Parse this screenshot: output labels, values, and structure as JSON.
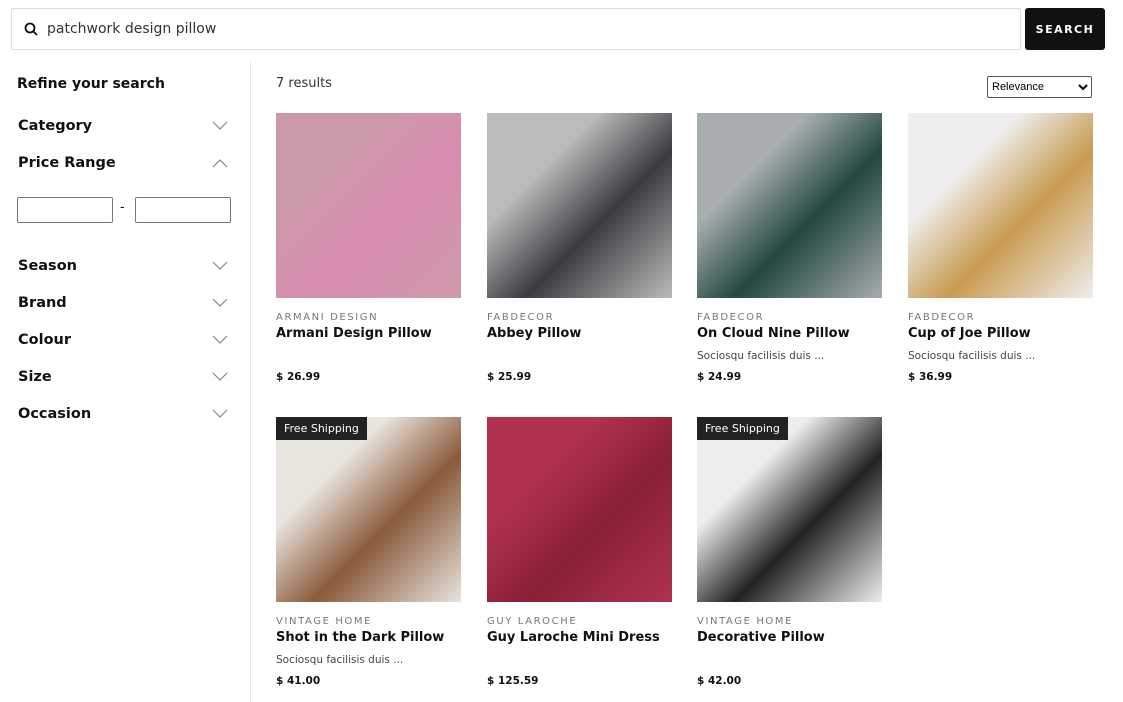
{
  "search": {
    "value": "patchwork design pillow",
    "button": "SEARCH",
    "icon": "search-icon"
  },
  "sidebar": {
    "title": "Refine your search",
    "facets": [
      {
        "label": "Category",
        "open": false
      },
      {
        "label": "Price Range",
        "open": true
      },
      {
        "label": "Season",
        "open": false
      },
      {
        "label": "Brand",
        "open": false
      },
      {
        "label": "Colour",
        "open": false
      },
      {
        "label": "Size",
        "open": false
      },
      {
        "label": "Occasion",
        "open": false
      }
    ],
    "price_separator": "-"
  },
  "results": {
    "count": "7 results",
    "sort": "Relevance"
  },
  "products": [
    {
      "brand": "ARMANI DESIGN",
      "title": "Armani Design Pillow",
      "desc": "",
      "price": "$ 26.99",
      "badge": "",
      "colors": [
        "#c9a",
        "#d88cb0"
      ]
    },
    {
      "brand": "FABDECOR",
      "title": "Abbey Pillow",
      "desc": "",
      "price": "$ 25.99",
      "badge": "",
      "colors": [
        "#bbb",
        "#3a3c40"
      ]
    },
    {
      "brand": "FABDECOR",
      "title": "On Cloud Nine Pillow",
      "desc": "Sociosqu facilisis duis ...",
      "price": "$ 24.99",
      "badge": "",
      "colors": [
        "#a8adb0",
        "#234840"
      ]
    },
    {
      "brand": "FABDECOR",
      "title": "Cup of Joe Pillow",
      "desc": "Sociosqu facilisis duis ...",
      "price": "$ 36.99",
      "badge": "",
      "colors": [
        "#eee",
        "#c99a50"
      ]
    },
    {
      "brand": "VINTAGE HOME",
      "title": "Shot in the Dark Pillow",
      "desc": "Sociosqu facilisis duis ...",
      "price": "$ 41.00",
      "badge": "Free Shipping",
      "colors": [
        "#e8e4de",
        "#8a5a3a"
      ]
    },
    {
      "brand": "GUY LAROCHE",
      "title": "Guy Laroche Mini Dress",
      "desc": "",
      "price": "$ 125.59",
      "badge": "",
      "colors": [
        "#b0324e",
        "#8a1f38"
      ]
    },
    {
      "brand": "VINTAGE HOME",
      "title": "Decorative Pillow",
      "desc": "",
      "price": "$ 42.00",
      "badge": "Free Shipping",
      "colors": [
        "#eee",
        "#222"
      ]
    }
  ]
}
